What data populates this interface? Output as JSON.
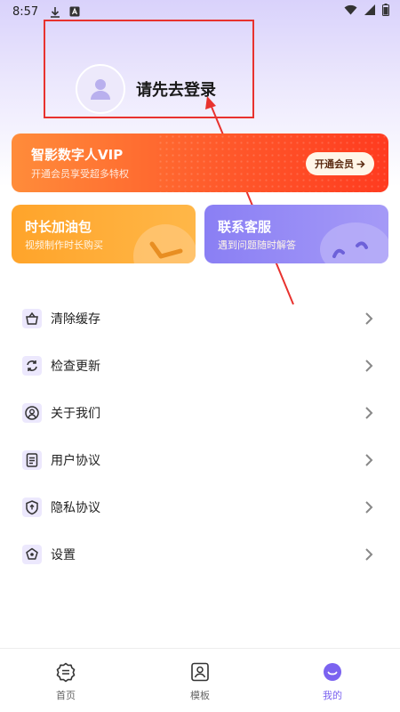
{
  "status_bar": {
    "time": "8:57"
  },
  "profile": {
    "login_text": "请先去登录"
  },
  "vip": {
    "title": "智影数字人VIP",
    "subtitle": "开通会员享受超多特权",
    "button_label": "开通会员"
  },
  "cards": {
    "time_pack": {
      "title": "时长加油包",
      "subtitle": "视频制作时长购买"
    },
    "service": {
      "title": "联系客服",
      "subtitle": "遇到问题随时解答"
    }
  },
  "menu": {
    "items": [
      {
        "label": "清除缓存",
        "icon": "basket-icon"
      },
      {
        "label": "检查更新",
        "icon": "refresh-icon"
      },
      {
        "label": "关于我们",
        "icon": "user-circle-icon"
      },
      {
        "label": "用户协议",
        "icon": "document-icon"
      },
      {
        "label": "隐私协议",
        "icon": "shield-icon"
      },
      {
        "label": "设置",
        "icon": "settings-icon"
      }
    ]
  },
  "bottom_nav": {
    "items": [
      {
        "label": "首页",
        "icon": "home-icon"
      },
      {
        "label": "模板",
        "icon": "template-icon"
      },
      {
        "label": "我的",
        "icon": "me-icon",
        "active": true
      }
    ]
  },
  "colors": {
    "accent": "#7b63f0",
    "vip_orange": "#ff5a2b",
    "time_card": "#ffa42a",
    "service_card": "#8a7ff4",
    "annotation_red": "#e8322e"
  }
}
